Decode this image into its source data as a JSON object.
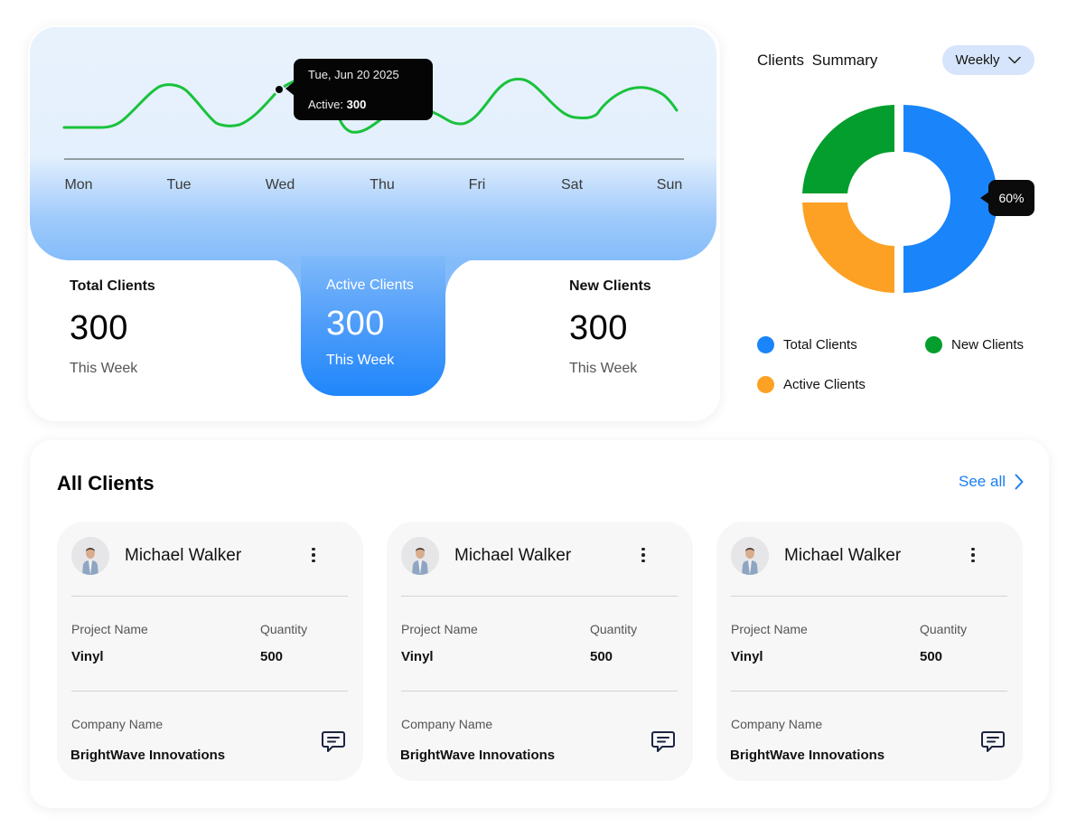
{
  "activity_chart": {
    "days": [
      "Mon",
      "Tue",
      "Wed",
      "Thu",
      "Fri",
      "Sat",
      "Sun"
    ],
    "line_color": "#19c23c",
    "tooltip": {
      "date": "Tue, Jun 20 2025",
      "active_label": "Active:",
      "active_value": "300"
    }
  },
  "stats": [
    {
      "title": "Total Clients",
      "value": "300",
      "period": "This Week"
    },
    {
      "title": "Active Clients",
      "value": "300",
      "period": "This Week"
    },
    {
      "title": "New Clients",
      "value": "300",
      "period": "This Week"
    }
  ],
  "summary": {
    "title": "Clients Summary",
    "range_button": "Weekly",
    "percent_badge": "60%",
    "segments": [
      {
        "name": "Total Clients",
        "color": "#1a84fa"
      },
      {
        "name": "Active Clients",
        "color": "#fca124"
      },
      {
        "name": "New Clients",
        "color": "#039e2d"
      }
    ],
    "legend": [
      "Total Clients",
      "New Clients",
      "Active Clients"
    ]
  },
  "clients": {
    "title": "All Clients",
    "see_all": "See all",
    "project_label": "Project Name",
    "quantity_label": "Quantity",
    "company_label": "Company Name",
    "items": [
      {
        "name": "Michael Walker",
        "project": "Vinyl",
        "quantity": "500",
        "company": "BrightWave Innovations"
      },
      {
        "name": "Michael Walker",
        "project": "Vinyl",
        "quantity": "500",
        "company": "BrightWave Innovations"
      },
      {
        "name": "Michael Walker",
        "project": "Vinyl",
        "quantity": "500",
        "company": "BrightWave Innovations"
      }
    ]
  },
  "icons": {
    "more": "more-vertical-icon",
    "chat": "chat-icon",
    "chevron_down": "chevron-down-icon",
    "chevron_right": "chevron-right-icon"
  }
}
